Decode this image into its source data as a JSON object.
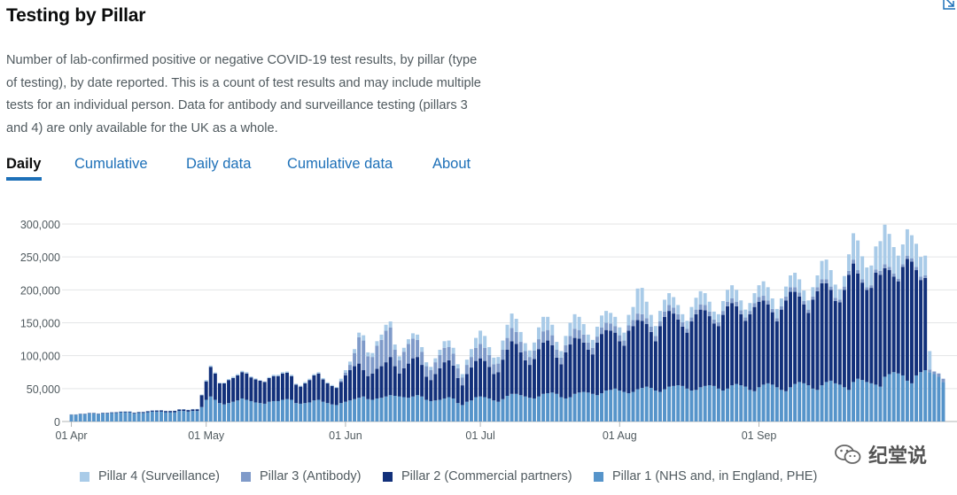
{
  "page": {
    "title": "Testing by Pillar",
    "description": "Number of lab-confirmed positive or negative COVID-19 test results, by pillar (type of testing), by date reported. This is a count of test results and may include multiple tests for an individual person. Data for antibody and surveillance testing (pillars 3 and 4) are only available for the UK as a whole.",
    "tabs": [
      {
        "label": "Daily",
        "active": true
      },
      {
        "label": "Cumulative",
        "active": false
      },
      {
        "label": "Daily data",
        "active": false
      },
      {
        "label": "Cumulative data",
        "active": false
      },
      {
        "label": "About",
        "active": false
      }
    ],
    "watermark": "纪堂说"
  },
  "chart_data": {
    "type": "bar",
    "stacked": true,
    "x_tick_labels": [
      "01 Apr",
      "01 May",
      "01 Jun",
      "01 Jul",
      "01 Aug",
      "01 Sep"
    ],
    "y_tick_labels": [
      "0",
      "50,000",
      "100,000",
      "150,000",
      "200,000",
      "250,000",
      "300,000"
    ],
    "ylim": [
      0,
      300000
    ],
    "grid": true,
    "legend_position": "bottom",
    "start_date": "2020-04-01",
    "colors": {
      "pillar1": "#5694ca",
      "pillar2": "#12307a",
      "pillar3": "#7f9ac9",
      "pillar4": "#a9cbe8"
    },
    "legend": [
      {
        "label": "Pillar 4 (Surveillance)",
        "color": "#a9cbe8"
      },
      {
        "label": "Pillar 3 (Antibody)",
        "color": "#7f9ac9"
      },
      {
        "label": "Pillar 2 (Commercial partners)",
        "color": "#12307a"
      },
      {
        "label": "Pillar 1 (NHS and, in England, PHE)",
        "color": "#5694ca"
      }
    ],
    "series": [
      {
        "name": "Pillar 1 (NHS and, in England, PHE)",
        "values": [
          10000,
          10000,
          11000,
          11000,
          12000,
          12000,
          11000,
          12000,
          12000,
          13000,
          13000,
          14000,
          14000,
          14000,
          12000,
          13000,
          13000,
          14000,
          15000,
          15000,
          15000,
          14000,
          14000,
          14000,
          16000,
          16000,
          15000,
          16000,
          16000,
          22000,
          33000,
          38000,
          33000,
          28000,
          26000,
          28000,
          30000,
          32000,
          35000,
          33000,
          31000,
          29000,
          28000,
          27000,
          30000,
          31000,
          31000,
          33000,
          34000,
          33000,
          28000,
          27000,
          28000,
          29000,
          32000,
          33000,
          30000,
          28000,
          26000,
          25000,
          28000,
          30000,
          32000,
          34000,
          36000,
          38000,
          34000,
          33000,
          35000,
          36000,
          38000,
          40000,
          39000,
          38000,
          37000,
          36000,
          38000,
          40000,
          38000,
          33000,
          31000,
          32000,
          33000,
          35000,
          37000,
          35000,
          28000,
          25000,
          30000,
          32000,
          37000,
          38000,
          37000,
          35000,
          32000,
          30000,
          34000,
          39000,
          42000,
          42000,
          40000,
          38000,
          36000,
          35000,
          38000,
          42000,
          43000,
          44000,
          42000,
          37000,
          35000,
          37000,
          42000,
          44000,
          45000,
          44000,
          42000,
          40000,
          43000,
          47000,
          48000,
          50000,
          47000,
          45000,
          43000,
          45000,
          49000,
          51000,
          53000,
          51000,
          47000,
          45000,
          49000,
          53000,
          54000,
          55000,
          54000,
          50000,
          47000,
          48000,
          52000,
          54000,
          55000,
          54000,
          50000,
          47000,
          50000,
          55000,
          57000,
          55000,
          53000,
          48000,
          46000,
          52000,
          56000,
          58000,
          56000,
          52000,
          48000,
          46000,
          52000,
          57000,
          60000,
          58000,
          55000,
          50000,
          48000,
          55000,
          60000,
          62000,
          58000,
          56000,
          52000,
          48000,
          60000,
          65000,
          63000,
          60000,
          58000,
          56000,
          53000,
          68000,
          72000,
          75000,
          73000,
          70000,
          62000,
          58000,
          70000,
          75000,
          78000,
          75000,
          72000,
          68000,
          60000
        ]
      },
      {
        "name": "Pillar 2 (Commercial partners)",
        "values": [
          500,
          500,
          600,
          600,
          700,
          700,
          800,
          800,
          900,
          900,
          1000,
          1000,
          1100,
          1100,
          1200,
          1300,
          1400,
          1500,
          1600,
          1700,
          1800,
          1900,
          2000,
          2100,
          2200,
          2300,
          2400,
          2500,
          2600,
          18000,
          28000,
          45000,
          40000,
          30000,
          32000,
          35000,
          36000,
          38000,
          40000,
          40000,
          36000,
          35000,
          34000,
          33000,
          36000,
          38000,
          38000,
          40000,
          40000,
          36000,
          28000,
          26000,
          30000,
          34000,
          38000,
          40000,
          34000,
          30000,
          28000,
          26000,
          32000,
          40000,
          46000,
          50000,
          52000,
          40000,
          35000,
          40000,
          45000,
          48000,
          52000,
          58000,
          45000,
          35000,
          44000,
          52000,
          58000,
          58000,
          48000,
          35000,
          32000,
          40000,
          48000,
          55000,
          56000,
          50000,
          38000,
          30000,
          42000,
          50000,
          55000,
          58000,
          55000,
          48000,
          40000,
          45000,
          60000,
          70000,
          80000,
          76000,
          65000,
          55000,
          50000,
          60000,
          72000,
          78000,
          80000,
          72000,
          55000,
          50000,
          70000,
          80000,
          85000,
          82000,
          75000,
          65000,
          60000,
          80000,
          90000,
          92000,
          90000,
          85000,
          75000,
          70000,
          95000,
          100000,
          105000,
          102000,
          95000,
          85000,
          75000,
          100000,
          110000,
          115000,
          110000,
          100000,
          90000,
          85000,
          105000,
          115000,
          118000,
          115000,
          105000,
          95000,
          95000,
          115000,
          125000,
          125000,
          118000,
          108000,
          100000,
          115000,
          128000,
          130000,
          128000,
          120000,
          110000,
          100000,
          122000,
          138000,
          145000,
          140000,
          130000,
          120000,
          110000,
          135000,
          150000,
          155000,
          150000,
          138000,
          125000,
          125000,
          148000,
          175000,
          180000,
          160000,
          148000,
          140000,
          145000,
          170000,
          170000,
          165000,
          158000,
          145000,
          140000,
          165000,
          185000,
          185000,
          160000,
          140000,
          140000
        ]
      },
      {
        "name": "Pillar 3 (Antibody)",
        "values": [
          0,
          0,
          0,
          0,
          0,
          0,
          0,
          0,
          0,
          0,
          0,
          0,
          0,
          0,
          0,
          0,
          0,
          0,
          0,
          0,
          0,
          0,
          0,
          0,
          0,
          0,
          0,
          0,
          0,
          0,
          0,
          0,
          0,
          0,
          0,
          0,
          0,
          0,
          0,
          0,
          0,
          0,
          0,
          0,
          0,
          0,
          0,
          0,
          0,
          0,
          0,
          0,
          0,
          0,
          0,
          0,
          0,
          0,
          0,
          0,
          2000,
          4000,
          8000,
          20000,
          40000,
          45000,
          30000,
          25000,
          35000,
          40000,
          48000,
          45000,
          25000,
          20000,
          25000,
          30000,
          30000,
          26000,
          20000,
          16000,
          15000,
          18000,
          20000,
          22000,
          20000,
          18000,
          15000,
          12000,
          14000,
          16000,
          20000,
          22000,
          20000,
          18000,
          15000,
          13000,
          15000,
          18000,
          20000,
          18000,
          16000,
          14000,
          12000,
          13000,
          15000,
          17000,
          16000,
          15000,
          12000,
          10000,
          11000,
          13000,
          14000,
          13000,
          12000,
          11000,
          10000,
          9000,
          10000,
          11000,
          11000,
          10000,
          9000,
          8000,
          8000,
          9000,
          10000,
          10000,
          9000,
          8000,
          8000,
          7000,
          8000,
          9000,
          9000,
          8000,
          7000,
          6000,
          6000,
          7000,
          8000,
          8000,
          7000,
          6000,
          6000,
          6000,
          7000,
          7000,
          7000,
          6000,
          5000,
          5000,
          6000,
          7000,
          7000,
          6000,
          5000,
          5000,
          5000,
          6000,
          7000,
          7000,
          6000,
          5000,
          5000,
          5000,
          6000,
          6000,
          6000,
          5000,
          5000,
          4000,
          5000,
          6000,
          6000,
          5000,
          5000,
          4000,
          4000,
          5000,
          6000,
          6000,
          5000,
          5000,
          4000,
          4000,
          5000,
          5000,
          5000,
          5000,
          4000,
          4000,
          4000,
          5000,
          5000,
          5000,
          4000,
          4000
        ]
      },
      {
        "name": "Pillar 4 (Surveillance)",
        "values": [
          500,
          500,
          500,
          500,
          500,
          500,
          500,
          500,
          500,
          500,
          500,
          500,
          500,
          500,
          500,
          500,
          500,
          500,
          500,
          500,
          500,
          500,
          500,
          500,
          500,
          500,
          500,
          500,
          500,
          1000,
          2000,
          2000,
          1500,
          1000,
          1000,
          1500,
          2000,
          2000,
          2000,
          2000,
          1500,
          1500,
          1000,
          1000,
          1500,
          2000,
          2000,
          2000,
          2000,
          2000,
          1500,
          1500,
          2000,
          2000,
          2000,
          2000,
          2000,
          1500,
          1500,
          1500,
          3000,
          4000,
          5000,
          6000,
          7000,
          8000,
          6000,
          6000,
          7000,
          8000,
          9000,
          9000,
          8000,
          6000,
          6000,
          7000,
          8000,
          8000,
          7000,
          6000,
          5000,
          6000,
          8000,
          10000,
          10000,
          9000,
          6000,
          5000,
          8000,
          12000,
          15000,
          20000,
          18000,
          12000,
          10000,
          10000,
          14000,
          20000,
          22000,
          20000,
          15000,
          12000,
          10000,
          12000,
          18000,
          22000,
          20000,
          16000,
          12000,
          10000,
          14000,
          20000,
          22000,
          20000,
          16000,
          12000,
          12000,
          15000,
          18000,
          18000,
          16000,
          14000,
          12000,
          12000,
          16000,
          20000,
          38000,
          40000,
          25000,
          18000,
          15000,
          16000,
          18000,
          18000,
          16000,
          14000,
          12000,
          12000,
          16000,
          18000,
          20000,
          18000,
          15000,
          12000,
          12000,
          15000,
          18000,
          20000,
          18000,
          15000,
          12000,
          12000,
          15000,
          18000,
          22000,
          20000,
          16000,
          14000,
          12000,
          15000,
          18000,
          22000,
          20000,
          16000,
          14000,
          14000,
          18000,
          28000,
          30000,
          25000,
          20000,
          16000,
          16000,
          25000,
          40000,
          45000,
          35000,
          30000,
          30000,
          35000,
          45000,
          60000,
          50000,
          40000,
          35000,
          30000,
          40000,
          35000,
          35000,
          30000,
          30000,
          28000
        ]
      }
    ]
  }
}
